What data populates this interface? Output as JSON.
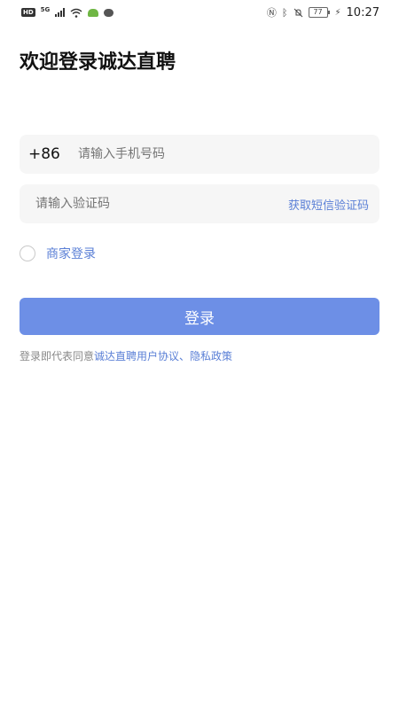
{
  "status_bar": {
    "hd": "HD",
    "network": "5G",
    "battery": "77",
    "time": "10:27"
  },
  "title": "欢迎登录诚达直聘",
  "phone": {
    "country_code": "+86",
    "placeholder": "请输入手机号码"
  },
  "code": {
    "placeholder": "请输入验证码",
    "get_code": "获取短信验证码"
  },
  "merchant_login": "商家登录",
  "login_button": "登录",
  "agreement": {
    "prefix": "登录即代表同意",
    "user_agreement": "诚达直聘用户协议",
    "separator": "、",
    "privacy_policy": "隐私政策"
  },
  "colors": {
    "accent": "#6d8fe6",
    "link": "#5a7fd6",
    "field_bg": "#f6f6f6"
  },
  "icons": [
    "hd-icon",
    "signal-icon",
    "wifi-icon",
    "app-icon",
    "message-icon",
    "nfc-icon",
    "bluetooth-icon",
    "mute-icon",
    "battery-icon",
    "charging-icon"
  ]
}
